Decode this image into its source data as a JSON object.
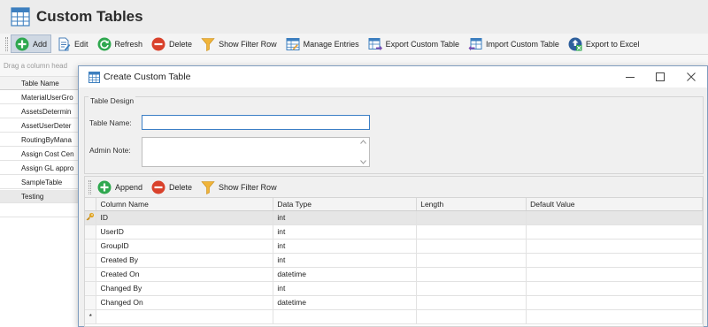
{
  "app": {
    "title": "Custom Tables",
    "icon": "table-grid-icon"
  },
  "toolbar": {
    "items": [
      {
        "label": "Add",
        "icon": "add-circle-icon"
      },
      {
        "label": "Edit",
        "icon": "edit-document-icon"
      },
      {
        "label": "Refresh",
        "icon": "refresh-icon"
      },
      {
        "label": "Delete",
        "icon": "delete-circle-icon"
      },
      {
        "label": "Show Filter Row",
        "icon": "filter-funnel-icon"
      },
      {
        "label": "Manage Entries",
        "icon": "manage-entries-icon"
      },
      {
        "label": "Export Custom Table",
        "icon": "export-table-icon"
      },
      {
        "label": "Import Custom Table",
        "icon": "import-table-icon"
      },
      {
        "label": "Export to Excel",
        "icon": "export-excel-icon"
      }
    ]
  },
  "background_grid": {
    "drag_hint": "Drag a column head",
    "header": "Table Name",
    "rows": [
      "MaterialUserGro",
      "AssetsDetermin",
      "AssetUserDeter",
      "RoutingByMana",
      "Assign Cost Cen",
      "Assign GL appro",
      "SampleTable",
      "Testing"
    ]
  },
  "dialog": {
    "title": "Create Custom Table",
    "controls": {
      "minimize": "–",
      "maximize": "☐",
      "close": "✕"
    },
    "design_group": "Table Design",
    "table_name_label": "Table Name:",
    "table_name_value": "",
    "admin_note_label": "Admin Note:",
    "admin_note_value": "",
    "column_toolbar": [
      {
        "label": "Append",
        "icon": "append-circle-icon"
      },
      {
        "label": "Delete",
        "icon": "delete-circle-icon"
      },
      {
        "label": "Show Filter Row",
        "icon": "filter-funnel-icon"
      }
    ],
    "column_headers": [
      "Column Name",
      "Data Type",
      "Length",
      "Default Value"
    ],
    "columns": [
      {
        "name": "ID",
        "type": "int",
        "length": "",
        "default": "",
        "key": true
      },
      {
        "name": "UserID",
        "type": "int",
        "length": "",
        "default": ""
      },
      {
        "name": "GroupID",
        "type": "int",
        "length": "",
        "default": ""
      },
      {
        "name": "Created By",
        "type": "int",
        "length": "",
        "default": ""
      },
      {
        "name": "Created On",
        "type": "datetime",
        "length": "",
        "default": ""
      },
      {
        "name": "Changed By",
        "type": "int",
        "length": "",
        "default": ""
      },
      {
        "name": "Changed On",
        "type": "datetime",
        "length": "",
        "default": ""
      }
    ],
    "new_row_marker": "*"
  },
  "colors": {
    "accent_green": "#2fa84f",
    "delete_red": "#d9412b",
    "filter_yellow": "#f0b43a",
    "focus_blue": "#3c7fc6"
  }
}
